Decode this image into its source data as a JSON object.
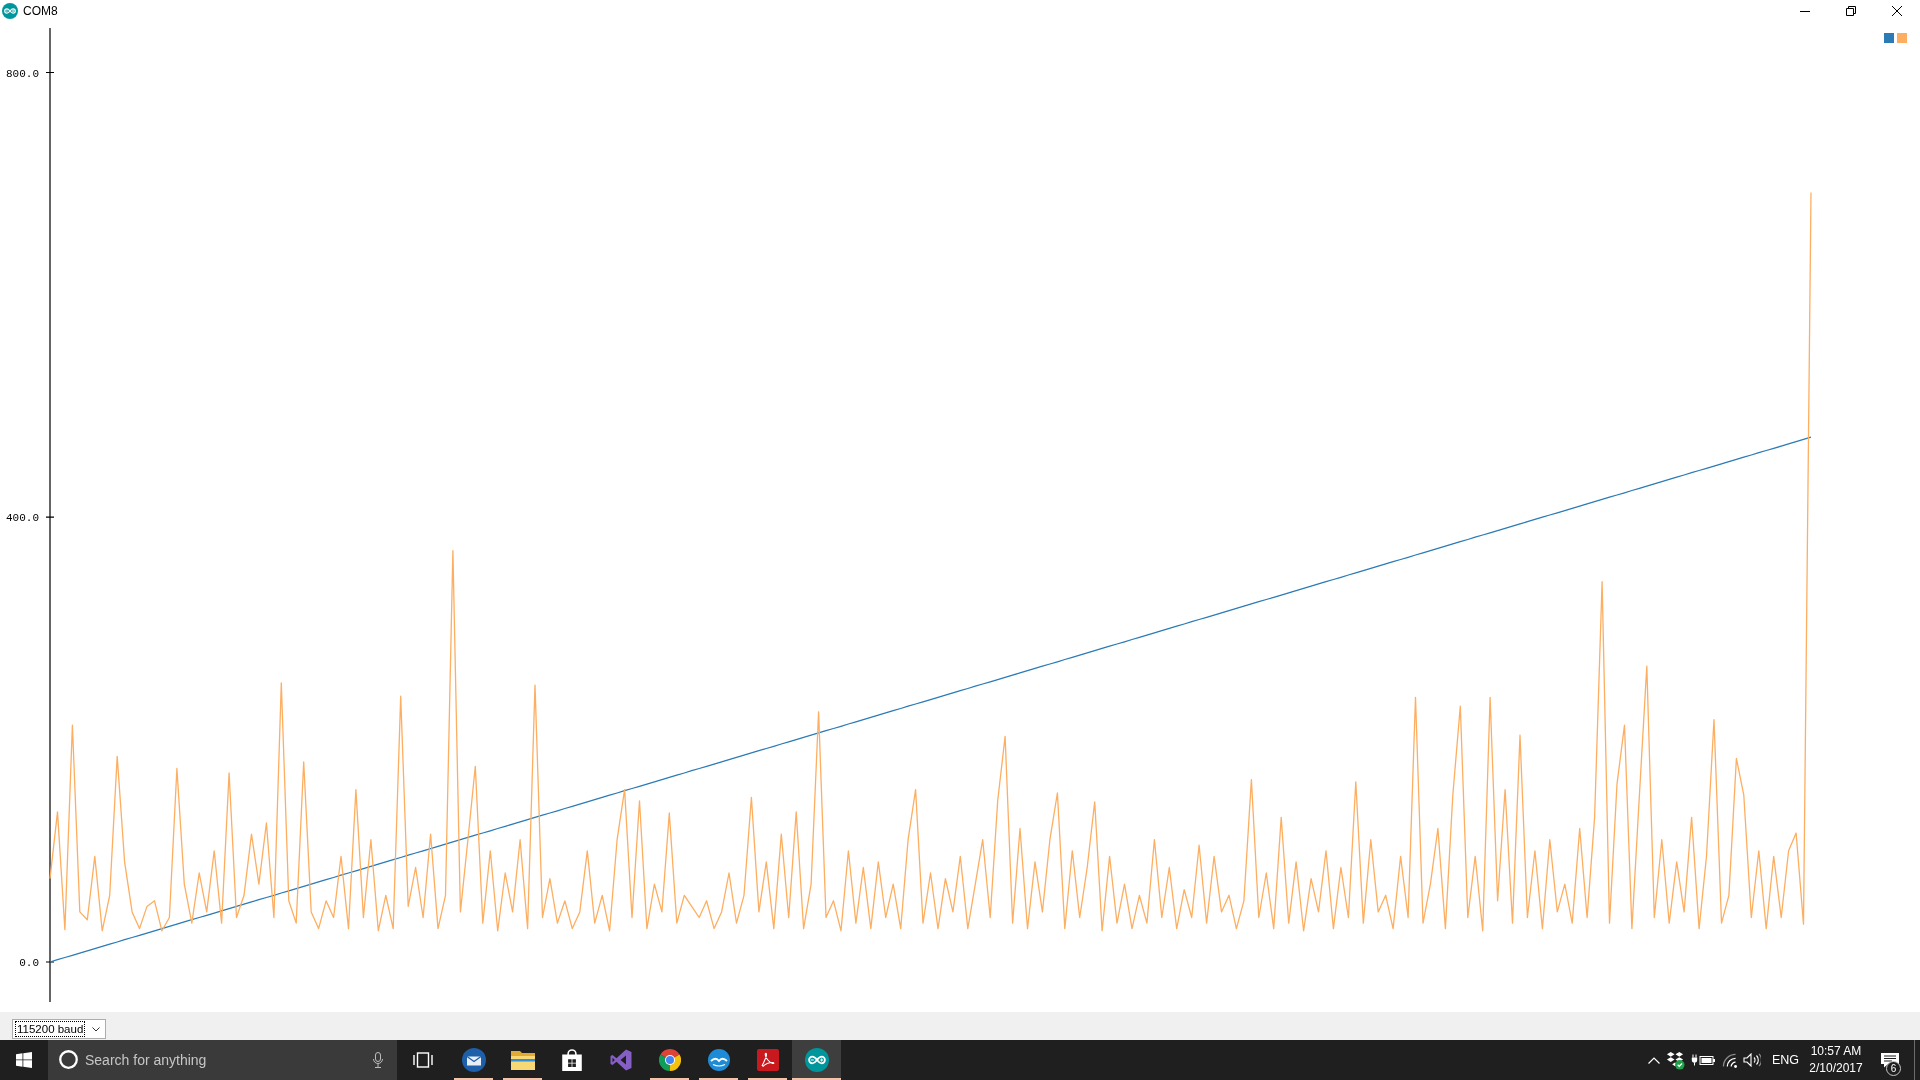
{
  "window": {
    "title": "COM8"
  },
  "plot": {
    "chart_data": {
      "type": "line",
      "ylim": [
        -36,
        840
      ],
      "yticks": [
        {
          "value": 0,
          "label": "0.0"
        },
        {
          "value": 400,
          "label": "400.0"
        },
        {
          "value": 800,
          "label": "800.0"
        }
      ],
      "series": [
        {
          "color": "#2c7bb6",
          "values": [
            0,
            2,
            4,
            6,
            8,
            10,
            12,
            14,
            16,
            18,
            20,
            22,
            24,
            26,
            28,
            30,
            32,
            34,
            36,
            38,
            40,
            42,
            44,
            46,
            48,
            50,
            52,
            54,
            56,
            58,
            60,
            62,
            64,
            66,
            68,
            70,
            72,
            74,
            76,
            78,
            80,
            82,
            84,
            86,
            88,
            90,
            92,
            94,
            96,
            98,
            100,
            102,
            104,
            106,
            108,
            110,
            112,
            114,
            116,
            118,
            120,
            122,
            124,
            126,
            128,
            130,
            132,
            134,
            136,
            138,
            140,
            142,
            144,
            146,
            148,
            150,
            152,
            154,
            156,
            158,
            160,
            162,
            164,
            166,
            168,
            170,
            172,
            174,
            176,
            178,
            180,
            182,
            184,
            186,
            188,
            190,
            192,
            194,
            196,
            198,
            200,
            202,
            204,
            206,
            208,
            210,
            212,
            214,
            216,
            218,
            220,
            222,
            224,
            226,
            228,
            230,
            232,
            234,
            236,
            238,
            240,
            242,
            244,
            246,
            248,
            250,
            252,
            254,
            256,
            258,
            260,
            262,
            264,
            266,
            268,
            270,
            272,
            274,
            276,
            278,
            280,
            282,
            284,
            286,
            288,
            290,
            292,
            294,
            296,
            298,
            300,
            302,
            304,
            306,
            308,
            310,
            312,
            314,
            316,
            318,
            320,
            322,
            324,
            326,
            328,
            330,
            332,
            334,
            336,
            338,
            340,
            342,
            344,
            346,
            348,
            350,
            352,
            354,
            356,
            358,
            360,
            362,
            364,
            366,
            368,
            370,
            372,
            374,
            376,
            378,
            380,
            382,
            384,
            386,
            388,
            390,
            392,
            394,
            396,
            398,
            400,
            402,
            404,
            406,
            408,
            410,
            412,
            414,
            416,
            418,
            420,
            422,
            424,
            426,
            428,
            430,
            432,
            434,
            436,
            438,
            440,
            442,
            444,
            446,
            448,
            450,
            452,
            454,
            456,
            458,
            460,
            462,
            464,
            466,
            468,
            470,
            472
          ]
        },
        {
          "color": "#fdae61",
          "values": [
            75,
            135,
            29,
            213,
            45,
            38,
            95,
            28,
            60,
            185,
            90,
            45,
            30,
            50,
            55,
            28,
            40,
            174,
            70,
            35,
            80,
            45,
            100,
            35,
            170,
            40,
            60,
            115,
            70,
            125,
            40,
            251,
            55,
            35,
            180,
            45,
            30,
            55,
            40,
            95,
            30,
            155,
            40,
            110,
            28,
            60,
            30,
            239,
            50,
            85,
            40,
            115,
            30,
            60,
            370,
            45,
            110,
            176,
            35,
            100,
            28,
            80,
            45,
            110,
            30,
            249,
            40,
            75,
            35,
            55,
            30,
            45,
            100,
            35,
            60,
            28,
            110,
            155,
            40,
            145,
            30,
            70,
            45,
            134,
            35,
            60,
            50,
            40,
            55,
            30,
            45,
            80,
            35,
            60,
            148,
            45,
            90,
            30,
            115,
            40,
            135,
            30,
            70,
            225,
            40,
            55,
            28,
            100,
            35,
            85,
            30,
            90,
            40,
            70,
            30,
            110,
            155,
            35,
            80,
            30,
            75,
            45,
            95,
            30,
            70,
            110,
            40,
            145,
            203,
            35,
            120,
            30,
            90,
            45,
            110,
            152,
            30,
            100,
            40,
            85,
            144,
            28,
            95,
            35,
            70,
            30,
            60,
            35,
            110,
            40,
            85,
            30,
            65,
            40,
            105,
            35,
            95,
            45,
            60,
            30,
            55,
            164,
            40,
            80,
            30,
            130,
            35,
            90,
            28,
            75,
            45,
            100,
            30,
            85,
            40,
            162,
            35,
            110,
            45,
            60,
            30,
            95,
            40,
            238,
            35,
            70,
            120,
            30,
            150,
            230,
            40,
            95,
            28,
            238,
            55,
            155,
            35,
            204,
            40,
            100,
            30,
            110,
            45,
            70,
            35,
            120,
            40,
            130,
            342,
            35,
            160,
            213,
            30,
            150,
            266,
            40,
            110,
            35,
            90,
            45,
            130,
            30,
            95,
            218,
            35,
            60,
            183,
            150,
            40,
            100,
            30,
            95,
            40,
            100,
            116,
            34,
            692
          ]
        }
      ]
    }
  },
  "bottom_bar": {
    "baud_rate": {
      "value": "115200 baud",
      "focused": true
    }
  },
  "taskbar": {
    "search": {
      "placeholder": "Search for anything"
    },
    "apps": [
      {
        "kind": "mail",
        "running": true,
        "selected": false
      },
      {
        "kind": "folder",
        "running": true,
        "selected": false
      },
      {
        "kind": "store",
        "running": false,
        "selected": false
      },
      {
        "kind": "ide",
        "running": false,
        "selected": false
      },
      {
        "kind": "browser",
        "running": true,
        "selected": false
      },
      {
        "kind": "office",
        "running": true,
        "selected": false
      },
      {
        "kind": "pdf",
        "running": true,
        "selected": false
      },
      {
        "kind": "serial",
        "running": true,
        "selected": true
      }
    ],
    "tray": {
      "language": "ENG",
      "time": "10:57 AM",
      "date": "2/10/2017",
      "notifications": "6"
    }
  }
}
